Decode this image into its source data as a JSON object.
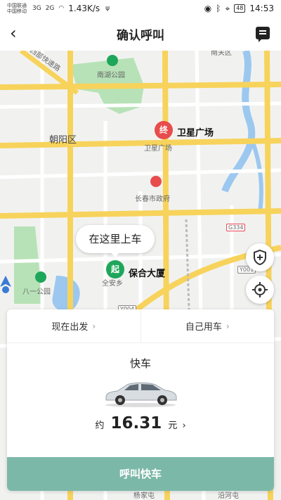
{
  "status_bar": {
    "carrier_1": "中国联通",
    "carrier_2": "中国移动",
    "signal_1": "3G",
    "signal_2": "2G",
    "net_speed": "1.43K/s",
    "battery": "48",
    "time": "14:53"
  },
  "nav": {
    "title": "确认呼叫"
  },
  "map": {
    "labels": {
      "district": "朝阳区",
      "park_nanhu": "南湖公园",
      "satellite_square": "卫星广场",
      "city_gov": "长春市政府",
      "park_bayi": "八一公园",
      "expressway": "西部快速路",
      "gov_road": "南关区",
      "lake_road": "杨家屯",
      "river_road": "沿河屯"
    },
    "road_codes": {
      "g334": "G334",
      "y001": "Y001",
      "y004": "Y004"
    },
    "destination_pin": "终",
    "destination_name": "卫星广场",
    "start_pin": "起",
    "start_name": "保合大厦",
    "start_sub": "全安乡",
    "bubble": "在这里上车"
  },
  "icons": {
    "back": "back-arrow-icon",
    "message": "message-icon",
    "safety": "shield-icon",
    "locate": "locate-icon"
  },
  "panel": {
    "depart_option": "现在出发",
    "rider_option": "自己用车",
    "car_type": "快车",
    "price_prefix": "约",
    "price_value": "16.31",
    "price_unit": "元",
    "call_button": "呼叫快车"
  },
  "colors": {
    "call_button": "#7cb8a8",
    "start_pin": "#1ea65a",
    "end_pin": "#e84c4c",
    "main_road": "#f7d35c",
    "water": "#9cc8f0",
    "park": "#a8dca8"
  }
}
